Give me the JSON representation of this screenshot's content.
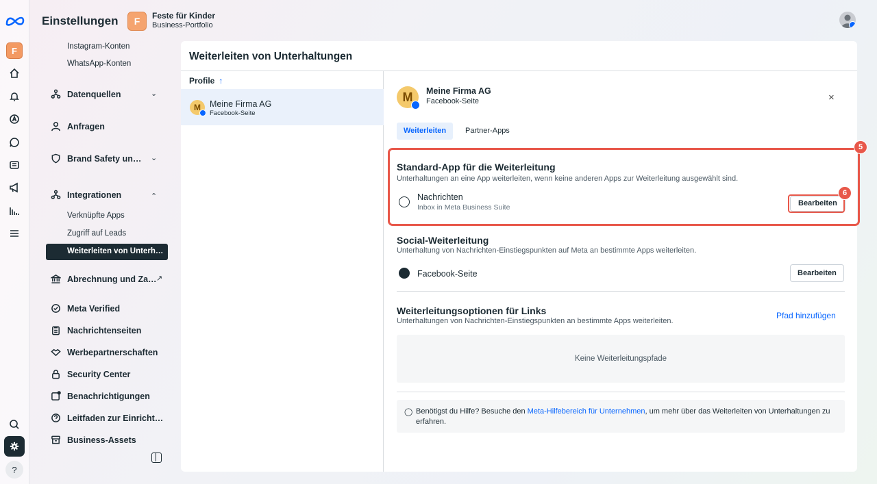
{
  "header": {
    "title": "Einstellungen",
    "portfolio_initial": "F",
    "portfolio_name": "Feste für Kinder",
    "portfolio_type": "Business-Portfolio"
  },
  "rail": {
    "initial": "F",
    "help": "?"
  },
  "sidebar": {
    "instagram": "Instagram-Konten",
    "whatsapp": "WhatsApp-Konten",
    "datenquellen": "Datenquellen",
    "anfragen": "Anfragen",
    "brand_safety": "Brand Safety un…",
    "integrationen": "Integrationen",
    "verknuepfte_apps": "Verknüpfte Apps",
    "zugriff_leads": "Zugriff auf Leads",
    "weiterleiten": "Weiterleiten von Unterh…",
    "abrechnung": "Abrechnung und Za…",
    "meta_verified": "Meta Verified",
    "nachrichtenseiten": "Nachrichtenseiten",
    "werbepartnerschaften": "Werbepartnerschaften",
    "security_center": "Security Center",
    "benachrichtigungen": "Benachrichtigungen",
    "leitfaden": "Leitfaden zur Einricht…",
    "business_assets": "Business-Assets"
  },
  "panel": {
    "title": "Weiterleiten von Unterhaltungen",
    "profiles_header": "Profile",
    "profiles_sort": "↑",
    "profile": {
      "initial": "M",
      "name": "Meine Firma AG",
      "type": "Facebook-Seite"
    }
  },
  "detail": {
    "initial": "M",
    "name": "Meine Firma AG",
    "type": "Facebook-Seite",
    "close": "×",
    "tab_active": "Weiterleiten",
    "tab_other": "Partner-Apps",
    "standard": {
      "title": "Standard-App für die Weiterleitung",
      "desc": "Unterhaltungen an eine App weiterleiten, wenn keine anderen Apps zur Weiterleitung ausgewählt sind.",
      "item_name": "Nachrichten",
      "item_sub": "Inbox in Meta Business Suite",
      "button": "Bearbeiten"
    },
    "social": {
      "title": "Social-Weiterleitung",
      "desc": "Unterhaltung von Nachrichten-Einstiegspunkten auf Meta an bestimmte Apps weiterleiten.",
      "item_name": "Facebook-Seite",
      "button": "Bearbeiten"
    },
    "links": {
      "title": "Weiterleitungsoptionen für Links",
      "desc": "Unterhaltungen von Nachrichten-Einstiegspunkten an bestimmte Apps weiterleiten.",
      "add": "Pfad hinzufügen",
      "empty": "Keine Weiterleitungspfade"
    },
    "help": {
      "pre": "Benötigst du Hilfe? Besuche den ",
      "link": "Meta-Hilfebereich für Unternehmen",
      "post": ", um mehr über das Weiterleiten von Unterhaltungen zu erfahren."
    }
  },
  "annotations": {
    "step5": "5",
    "step6": "6"
  },
  "colors": {
    "accent": "#0866ff",
    "highlight": "#e8584a",
    "dark": "#1c2b33"
  }
}
